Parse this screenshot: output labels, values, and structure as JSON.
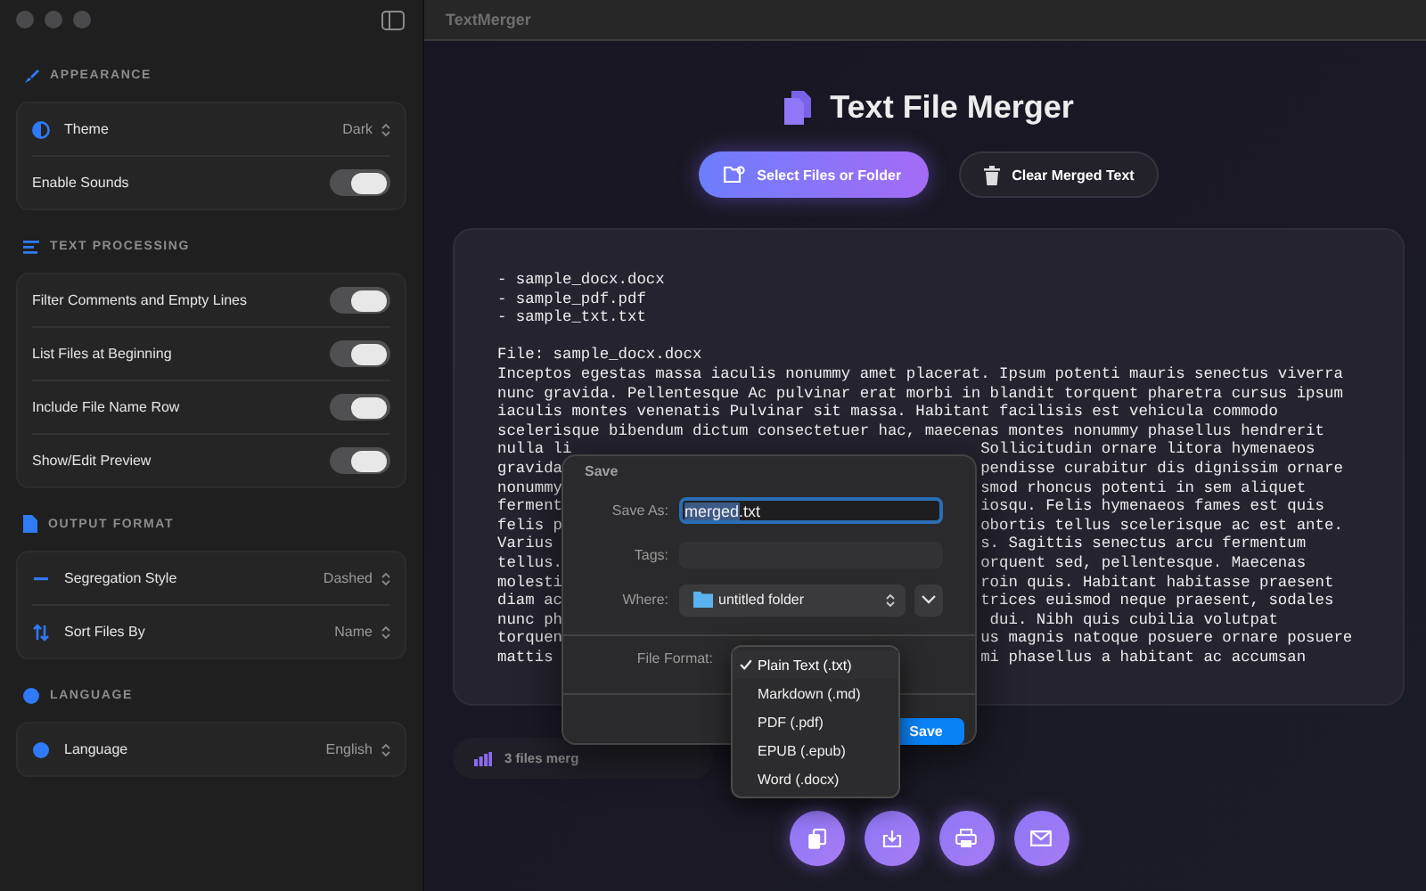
{
  "window": {
    "title": "TextMerger"
  },
  "sidebar": {
    "sections": [
      {
        "title": "APPEARANCE",
        "rows": [
          {
            "kind": "select",
            "label": "Theme",
            "value": "Dark"
          },
          {
            "kind": "toggle",
            "label": "Enable Sounds",
            "on": true
          }
        ]
      },
      {
        "title": "TEXT PROCESSING",
        "rows": [
          {
            "kind": "toggle",
            "label": "Filter Comments and Empty Lines",
            "on": true
          },
          {
            "kind": "toggle",
            "label": "List Files at Beginning",
            "on": true
          },
          {
            "kind": "toggle",
            "label": "Include File Name Row",
            "on": true
          },
          {
            "kind": "toggle",
            "label": "Show/Edit Preview",
            "on": true
          }
        ]
      },
      {
        "title": "OUTPUT FORMAT",
        "rows": [
          {
            "kind": "select",
            "label": "Segregation Style",
            "value": "Dashed"
          },
          {
            "kind": "select",
            "label": "Sort Files By",
            "value": "Name"
          }
        ]
      },
      {
        "title": "LANGUAGE",
        "rows": [
          {
            "kind": "select",
            "label": "Language",
            "value": "English"
          }
        ]
      }
    ]
  },
  "header": {
    "title": "Text File Merger"
  },
  "actions": [
    {
      "kind": "primary",
      "label": "Select Files or Folder"
    },
    {
      "kind": "secondary",
      "label": "Clear Merged Text"
    }
  ],
  "preview": {
    "file_list": [
      "- sample_docx.docx",
      "- sample_pdf.pdf",
      "- sample_txt.txt"
    ],
    "file_header": "File: sample_docx.docx",
    "lines": [
      {
        "left": "Inceptos egestas massa iaculis nonummy amet placerat. Ipsum potenti mauris senectus viverra"
      },
      {
        "left": "nunc gravida. Pellentesque Ac pulvinar erat morbi in blandit torquent pharetra cursus ipsum"
      },
      {
        "left": "iaculis montes venenatis Pulvinar sit massa. Habitant facilisis est vehicula commodo"
      },
      {
        "left": "scelerisque bibendum dictum consectetuer hac, maecenas montes nonummy phasellus hendrerit"
      },
      {
        "left": "nulla li",
        "right": "Sollicitudin ornare litora hymenaeos"
      },
      {
        "left": "gravida",
        "right": "pendisse curabitur dis dignissim ornare"
      },
      {
        "left": "nonummy",
        "right": "smod rhoncus potenti in sem aliquet"
      },
      {
        "left": "ferment",
        "right": "iosqu. Felis hymenaeos fames est quis"
      },
      {
        "left": "felis p",
        "right": "obortis tellus scelerisque ac est ante."
      },
      {
        "left": "Varius",
        "right": "s. Sagittis senectus arcu fermentum"
      },
      {
        "left": "tellus.",
        "right": "orquent sed, pellentesque. Maecenas"
      },
      {
        "left": "molesti",
        "right": "roin quis. Habitant habitasse praesent"
      },
      {
        "left": "diam ac",
        "right": "trices euismod neque praesent, sodales"
      },
      {
        "left": "nunc ph",
        "right": " dui. Nibh quis cubilia volutpat"
      },
      {
        "left": "torquen",
        "right": "us magnis natoque posuere ornare posuere"
      },
      {
        "left": "mattis",
        "right": "mi phasellus a habitant ac accumsan"
      }
    ]
  },
  "status": {
    "text": "3 files merg"
  },
  "save_dialog": {
    "title": "Save",
    "save_as_label": "Save As:",
    "save_as_selected": "merged",
    "save_as_rest": ".txt",
    "tags_label": "Tags:",
    "where_label": "Where:",
    "where_value": "untitled folder",
    "format_label": "File Format:",
    "save_button": "Save",
    "format_menu": [
      {
        "label": "Plain Text (.txt)",
        "selected": true
      },
      {
        "label": "Markdown (.md)",
        "selected": false
      },
      {
        "label": "PDF (.pdf)",
        "selected": false
      },
      {
        "label": "EPUB (.epub)",
        "selected": false
      },
      {
        "label": "Word (.docx)",
        "selected": false
      }
    ]
  },
  "bottom_actions": [
    {
      "kind": "copy"
    },
    {
      "kind": "download"
    },
    {
      "kind": "print"
    },
    {
      "kind": "mail"
    }
  ]
}
